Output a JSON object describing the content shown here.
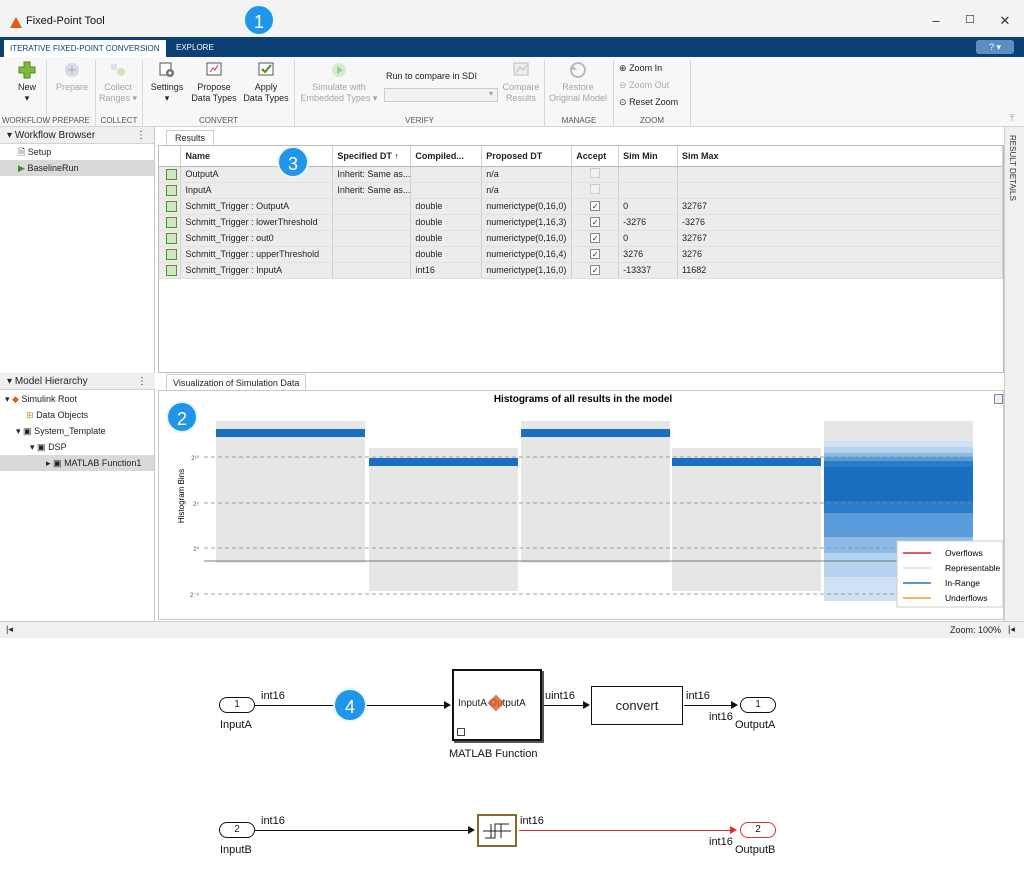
{
  "window": {
    "title": "Fixed-Point Tool",
    "minimize": "–",
    "maximize": "☐",
    "close": "✕"
  },
  "tabs": [
    {
      "label": "ITERATIVE FIXED-POINT CONVERSION"
    },
    {
      "label": "EXPLORE"
    }
  ],
  "help_label": "?",
  "ribbon": {
    "new": "New",
    "prepare": "Prepare",
    "collect_ranges": [
      "Collect",
      "Ranges"
    ],
    "settings": "Settings",
    "propose": [
      "Propose",
      "Data Types"
    ],
    "apply": [
      "Apply",
      "Data Types"
    ],
    "simulate": [
      "Simulate with",
      "Embedded Types"
    ],
    "run_to_compare": "Run to compare in SDI",
    "compare": [
      "Compare",
      "Results"
    ],
    "restore": [
      "Restore",
      "Original Model"
    ],
    "zoom_in": "Zoom In",
    "zoom_out": "Zoom Out",
    "reset_zoom": "Reset Zoom",
    "sections": {
      "workflow": "WORKFLOW",
      "prepare": "PREPARE",
      "collect": "COLLECT",
      "convert": "CONVERT",
      "verify": "VERIFY",
      "manage": "MANAGE",
      "zoom": "ZOOM"
    }
  },
  "workflow_browser": {
    "title": "Workflow Browser",
    "items": [
      "Setup",
      "BaselineRun"
    ]
  },
  "model_hierarchy": {
    "title": "Model Hierarchy",
    "items": [
      "Simulink Root",
      "Data Objects",
      "System_Template",
      "DSP",
      "MATLAB Function1"
    ]
  },
  "results": {
    "tab": "Results",
    "columns": [
      "Name",
      "Specified DT ↑",
      "Compiled...",
      "Proposed DT",
      "Accept",
      "Sim Min",
      "Sim Max"
    ],
    "rows": [
      {
        "name": "OutputA",
        "specified": "Inherit: Same as...",
        "compiled": "",
        "proposed": "n/a",
        "accept": "disabled",
        "min": "",
        "max": ""
      },
      {
        "name": "InputA",
        "specified": "Inherit: Same as...",
        "compiled": "",
        "proposed": "n/a",
        "accept": "disabled",
        "min": "",
        "max": ""
      },
      {
        "name": "Schmitt_Trigger : OutputA",
        "specified": "",
        "compiled": "double",
        "proposed": "numerictype(0,16,0)",
        "accept": "checked",
        "min": "0",
        "max": "32767"
      },
      {
        "name": "Schmitt_Trigger : lowerThreshold",
        "specified": "",
        "compiled": "double",
        "proposed": "numerictype(1,16,3)",
        "accept": "checked",
        "min": "-3276",
        "max": "-3276"
      },
      {
        "name": "Schmitt_Trigger : out0",
        "specified": "",
        "compiled": "double",
        "proposed": "numerictype(0,16,0)",
        "accept": "checked",
        "min": "0",
        "max": "32767"
      },
      {
        "name": "Schmitt_Trigger : upperThreshold",
        "specified": "",
        "compiled": "double",
        "proposed": "numerictype(0,16,4)",
        "accept": "checked",
        "min": "3276",
        "max": "3276"
      },
      {
        "name": "Schmitt_Trigger : InputA",
        "specified": "",
        "compiled": "int16",
        "proposed": "numerictype(1,16,0)",
        "accept": "checked",
        "min": "-13337",
        "max": "11682"
      }
    ]
  },
  "visualization": {
    "tab": "Visualization of Simulation Data",
    "title": "Histograms of all results in the model",
    "ylabel": "Histogram Bins",
    "yticks": [
      "2¹⁰",
      "2⁵",
      "2⁰",
      "2⁻⁵"
    ],
    "legend": [
      {
        "label": "Overflows",
        "color": "#d62728"
      },
      {
        "label": "Representable",
        "color": "#dddddd"
      },
      {
        "label": "In-Range",
        "color": "#1f77c4"
      },
      {
        "label": "Underflows",
        "color": "#f0a020"
      }
    ]
  },
  "result_details": "RESULT DETAILS",
  "status": {
    "zoom": "Zoom: 100%"
  },
  "callouts": [
    "1",
    "2",
    "3",
    "4"
  ],
  "diagram": {
    "inputA": {
      "num": "1",
      "name": "InputA",
      "type": "int16"
    },
    "matlab_fn": {
      "ports": "InputA OutputA",
      "label": "MATLAB Function",
      "out_type": "uint16"
    },
    "convert": {
      "label": "convert",
      "out_type": "int16",
      "in_type": "int16"
    },
    "outputA": {
      "num": "1",
      "name": "OutputA"
    },
    "inputB": {
      "num": "2",
      "name": "InputB",
      "type": "int16"
    },
    "relay": {
      "out_type": "int16",
      "in_type": "int16"
    },
    "outputB": {
      "num": "2",
      "name": "OutputB"
    }
  }
}
